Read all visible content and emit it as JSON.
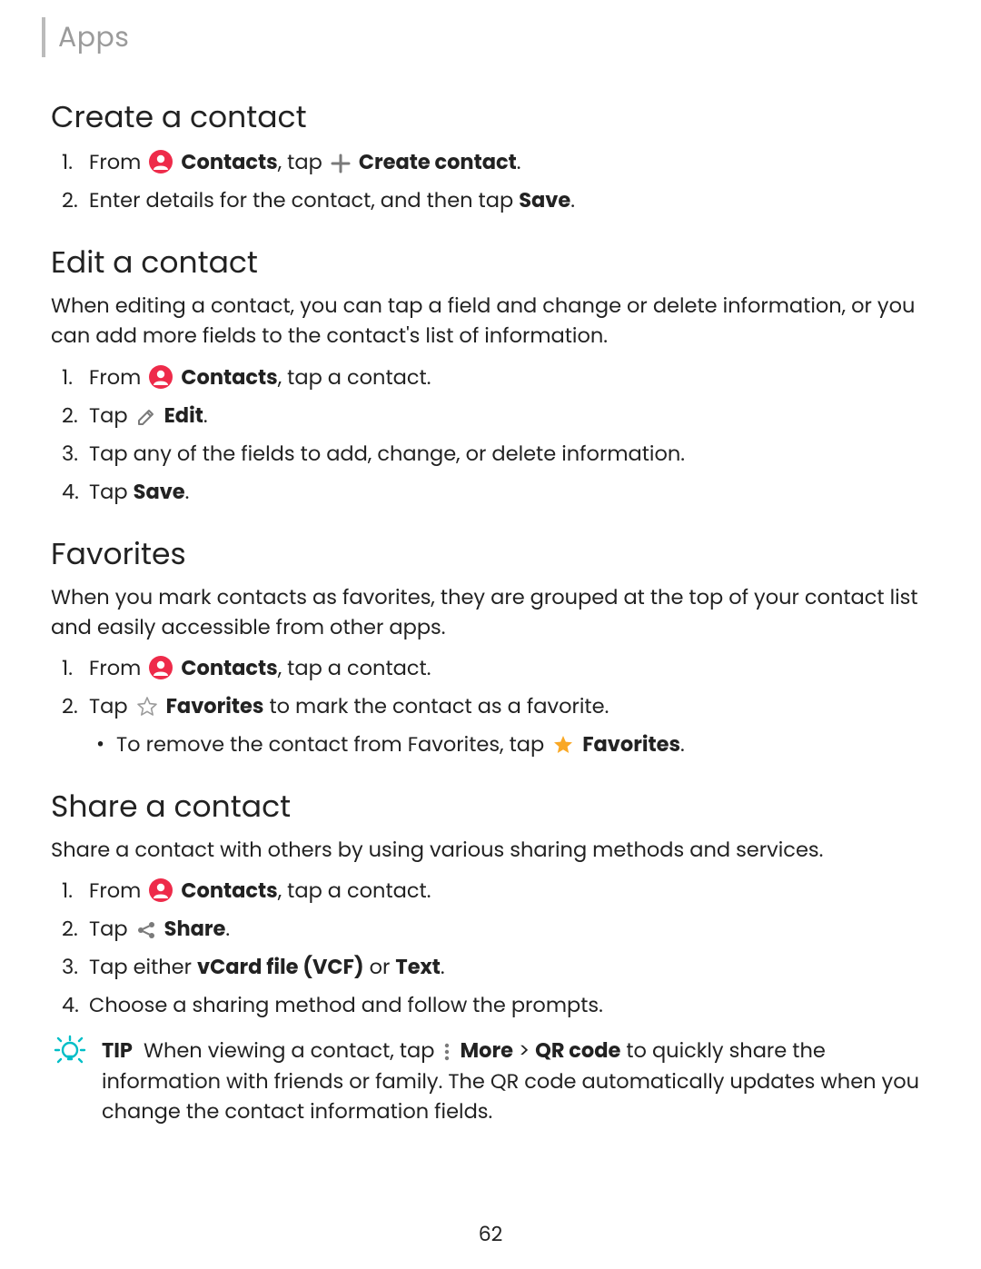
{
  "running_head": "Apps",
  "page_number": "62",
  "ui": {
    "contacts_label": "Contacts",
    "create_contact_label": "Create contact",
    "save_label": "Save",
    "edit_label": "Edit",
    "favorites_label": "Favorites",
    "share_label": "Share",
    "vcard_label": "vCard file (VCF)",
    "text_label": "Text",
    "more_label": "More",
    "qr_label": "QR code",
    "tip_label": "TIP"
  },
  "sections": {
    "create": {
      "heading": "Create a contact",
      "step1_a": "From ",
      "step1_b": ", tap ",
      "step1_c": ".",
      "step2_a": "Enter details for the contact, and then tap ",
      "step2_b": "."
    },
    "edit": {
      "heading": "Edit a contact",
      "intro": "When editing a contact, you can tap a field and change or delete information, or you can add more fields to the contact's list of information.",
      "step1_a": "From ",
      "step1_b": ", tap a contact.",
      "step2_a": "Tap ",
      "step2_b": ".",
      "step3": "Tap any of the fields to add, change, or delete information.",
      "step4_a": "Tap ",
      "step4_b": "."
    },
    "favorites": {
      "heading": "Favorites",
      "intro": "When you mark contacts as favorites, they are grouped at the top of your contact list and easily accessible from other apps.",
      "step1_a": "From ",
      "step1_b": ", tap a contact.",
      "step2_a": "Tap ",
      "step2_b": " to mark the contact as a favorite.",
      "sub_a": "To remove the contact from Favorites, tap ",
      "sub_b": "."
    },
    "share": {
      "heading": "Share a contact",
      "intro": "Share a contact with others by using various sharing methods and services.",
      "step1_a": "From ",
      "step1_b": ", tap a contact.",
      "step2_a": "Tap ",
      "step2_b": ".",
      "step3_a": "Tap either ",
      "step3_b": " or ",
      "step3_c": ".",
      "step4": "Choose a sharing method and follow the prompts.",
      "tip_a": "When viewing a contact, tap ",
      "tip_b": " > ",
      "tip_c": " to quickly share the information with friends or family. The QR code automatically updates when you change the contact information fields."
    }
  }
}
